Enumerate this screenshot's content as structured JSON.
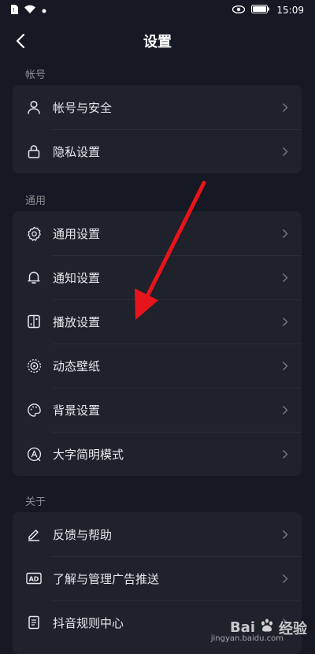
{
  "status_bar": {
    "time": "15:09"
  },
  "header": {
    "title": "设置"
  },
  "sections": [
    {
      "title": "帐号",
      "items": [
        {
          "label": "帐号与安全",
          "icon": "user-icon"
        },
        {
          "label": "隐私设置",
          "icon": "lock-icon"
        }
      ]
    },
    {
      "title": "通用",
      "items": [
        {
          "label": "通用设置",
          "icon": "gear-icon"
        },
        {
          "label": "通知设置",
          "icon": "bell-icon"
        },
        {
          "label": "播放设置",
          "icon": "play-settings-icon"
        },
        {
          "label": "动态壁纸",
          "icon": "live-wallpaper-icon"
        },
        {
          "label": "背景设置",
          "icon": "palette-icon"
        },
        {
          "label": "大字简明模式",
          "icon": "large-text-icon"
        }
      ]
    },
    {
      "title": "关于",
      "items": [
        {
          "label": "反馈与帮助",
          "icon": "pen-icon"
        },
        {
          "label": "了解与管理广告推送",
          "icon": "ad-icon"
        },
        {
          "label": "抖音规则中心",
          "icon": "document-icon"
        }
      ]
    }
  ],
  "watermark": {
    "brand": "Bai",
    "cn": "经验",
    "url": "jingyan.baidu.com"
  },
  "colors": {
    "background": "#161823",
    "card": "#1f212b",
    "arrow": "#e8141b"
  }
}
